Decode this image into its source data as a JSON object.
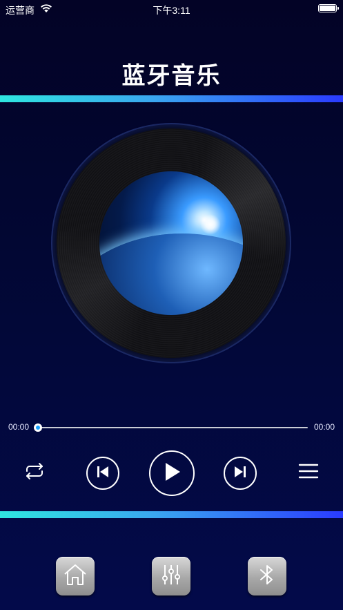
{
  "status_bar": {
    "carrier": "运营商",
    "time": "下午3:11"
  },
  "header": {
    "title": "蓝牙音乐"
  },
  "player": {
    "current_time": "00:00",
    "total_time": "00:00",
    "progress": 0,
    "state": "paused"
  },
  "controls": {
    "icons": [
      "repeat-icon",
      "previous-icon",
      "play-icon",
      "next-icon",
      "playlist-icon"
    ]
  },
  "dock": {
    "icons": [
      "home-icon",
      "equalizer-icon",
      "bluetooth-icon"
    ]
  },
  "colors": {
    "background_top": "#030326",
    "background_bottom": "#030a4a",
    "accent_start": "#2fe6e0",
    "accent_end": "#2a3bff",
    "progress_knob": "#1aa3ff"
  }
}
